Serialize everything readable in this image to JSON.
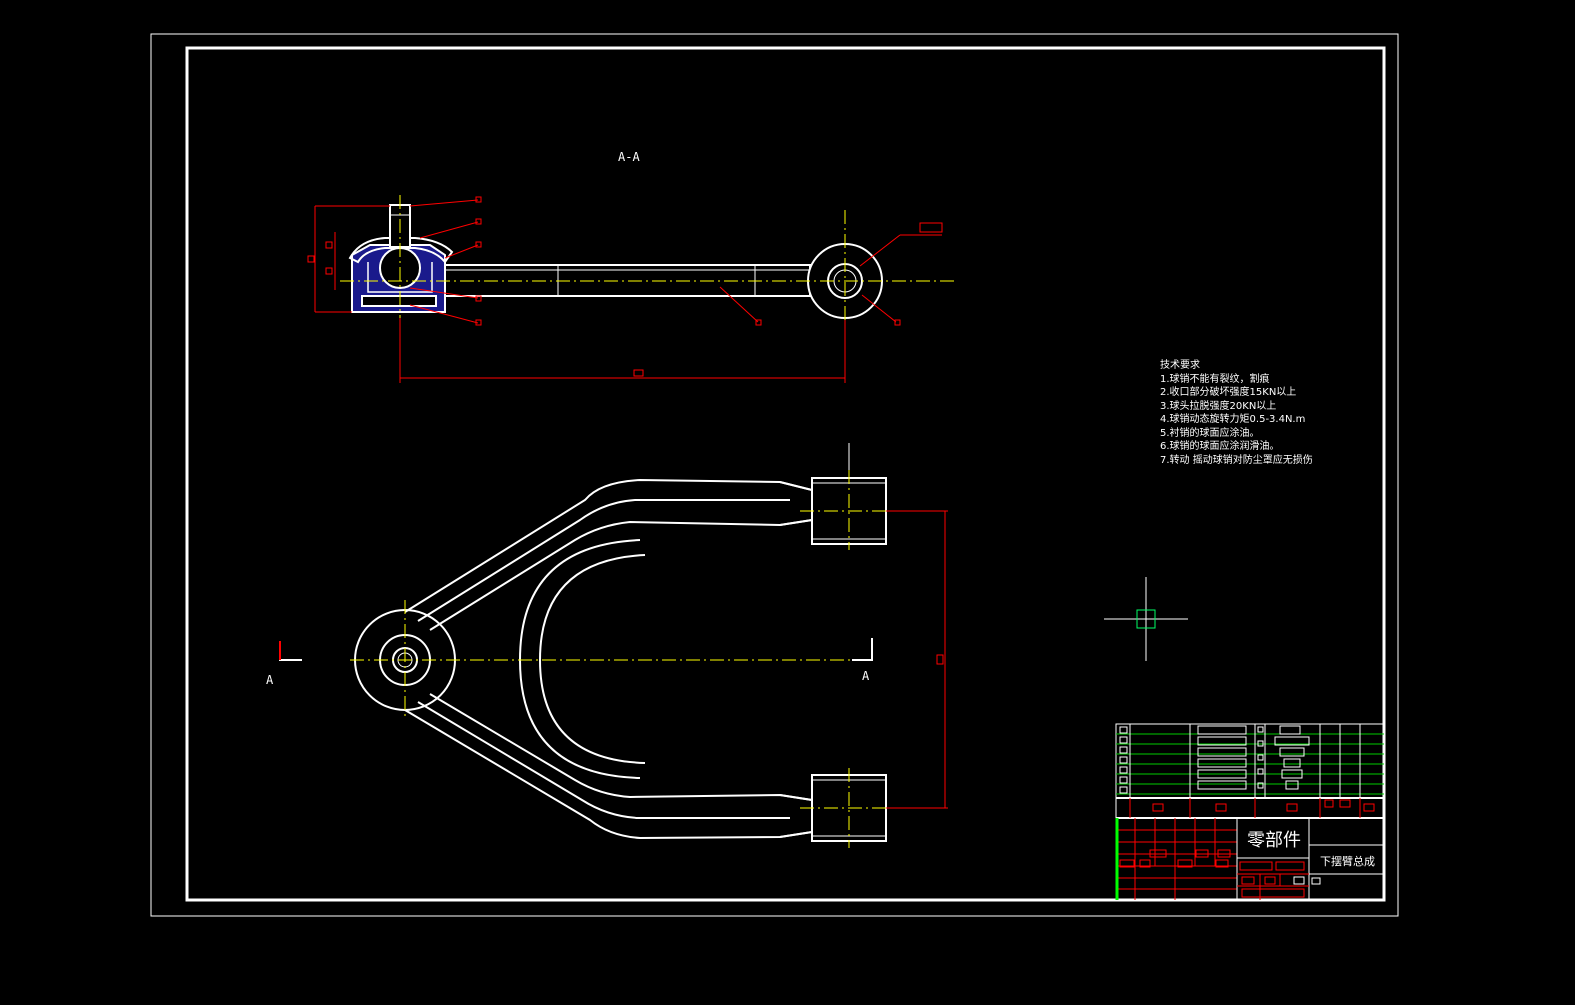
{
  "section_label": "A-A",
  "section_marker_left": "A",
  "section_marker_right": "A",
  "technical_requirements": {
    "title": "技术要求",
    "items": [
      "1.球销不能有裂纹，割痕",
      "2.收口部分破坏强度15KN以上",
      "3.球头拉脱强度20KN以上",
      "4.球销动态旋转力矩0.5-3.4N.m",
      "5.衬销的球面应涂油。",
      "6.球销的球面应涂润滑油。",
      "7.转动 摇动球销对防尘罩应无损伤"
    ]
  },
  "title_block": {
    "part_label": "零部件",
    "drawing_name": "下摆臂总成"
  },
  "colors": {
    "background": "#000000",
    "outline": "#ffffff",
    "dimension": "#ff0000",
    "centerline": "#ffff00",
    "hatch": "#1a1a8c",
    "table_grid": "#00cc00",
    "cursor": "#00ff66"
  }
}
